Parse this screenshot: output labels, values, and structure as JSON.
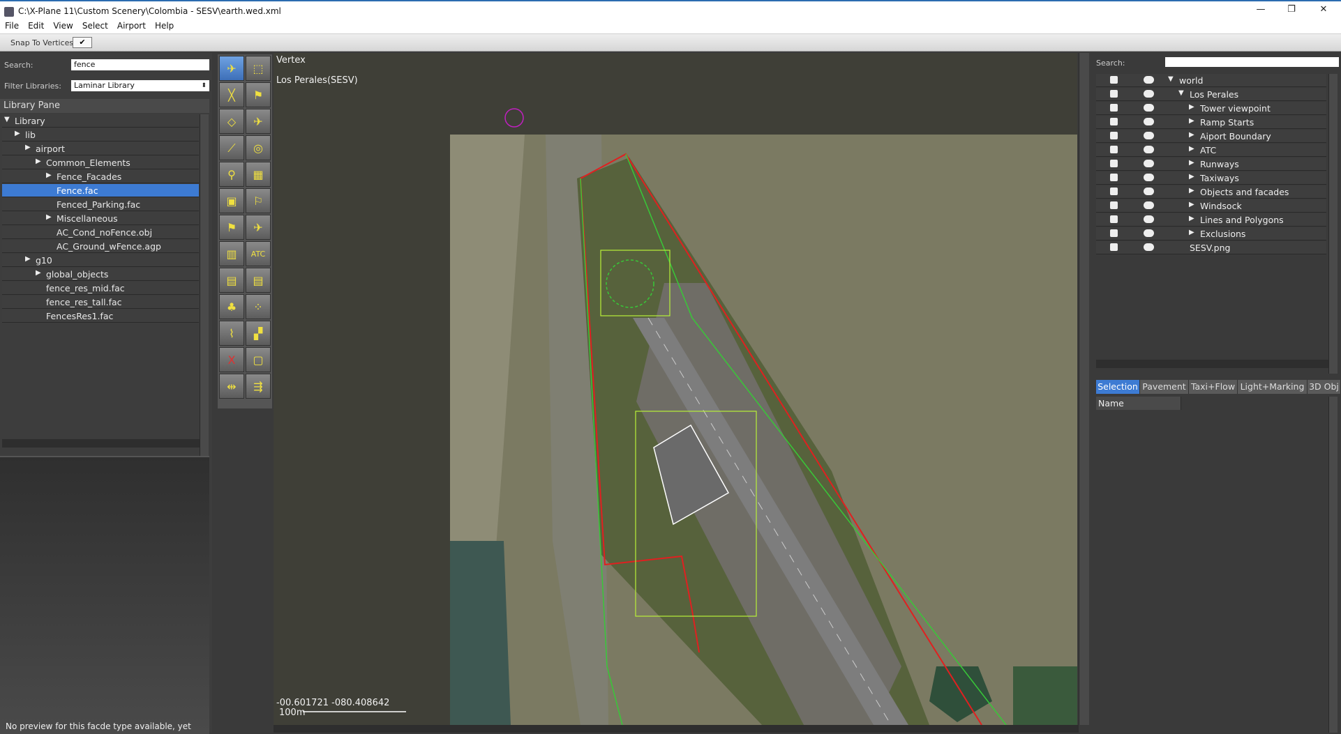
{
  "window": {
    "title": "C:\\X-Plane 11\\Custom Scenery\\Colombia - SESV\\earth.wed.xml",
    "minimize": "—",
    "restore": "❐",
    "close": "✕"
  },
  "menu": [
    "File",
    "Edit",
    "View",
    "Select",
    "Airport",
    "Help"
  ],
  "toolbar": {
    "snap_label": "Snap To Vertices",
    "snap_checked": "✔"
  },
  "library": {
    "search_label": "Search:",
    "search_value": "fence",
    "filter_label": "Filter Libraries:",
    "filter_value": "Laminar Library",
    "pane_title": "Library Pane",
    "items": [
      {
        "label": "Library",
        "arrow": "▼"
      },
      {
        "label": "lib",
        "arrow": "▶"
      },
      {
        "label": "airport",
        "arrow": "▶"
      },
      {
        "label": "Common_Elements",
        "arrow": "▶"
      },
      {
        "label": "Fence_Facades",
        "arrow": "▶"
      },
      {
        "label": "Fence.fac",
        "arrow": ""
      },
      {
        "label": "Fenced_Parking.fac",
        "arrow": ""
      },
      {
        "label": "Miscellaneous",
        "arrow": "▶"
      },
      {
        "label": "AC_Cond_noFence.obj",
        "arrow": ""
      },
      {
        "label": "AC_Ground_wFence.agp",
        "arrow": ""
      },
      {
        "label": "g10",
        "arrow": "▶"
      },
      {
        "label": "global_objects",
        "arrow": "▶"
      },
      {
        "label": "fence_res_mid.fac",
        "arrow": ""
      },
      {
        "label": "fence_res_tall.fac",
        "arrow": ""
      },
      {
        "label": "FencesRes1.fac",
        "arrow": ""
      }
    ],
    "preview_message": "No preview for this facde type available, yet"
  },
  "tools": [
    "✈",
    "⬚",
    "╳",
    "⚑",
    "◇",
    "✈",
    "⟋",
    "◎",
    "⚲",
    "▦",
    "▣",
    "⚐",
    "⚑",
    "✈",
    "▥",
    "ATC",
    "▤",
    "▤",
    "♣",
    "⁘",
    "⌇",
    "▞",
    "X",
    "▢",
    "⇹",
    "⇶"
  ],
  "map": {
    "tool_name": "Vertex",
    "airport_name": "Los Perales(SESV)",
    "coordinates": "-00.601721 -080.408642",
    "scale_label": "100m"
  },
  "hierarchy": {
    "search_label": "Search:",
    "search_value": "",
    "items": [
      {
        "label": "world",
        "arrow": "▼",
        "depth": 0
      },
      {
        "label": "Los Perales",
        "arrow": "▼",
        "depth": 1
      },
      {
        "label": "Tower viewpoint",
        "arrow": "▶",
        "depth": 2
      },
      {
        "label": "Ramp Starts",
        "arrow": "▶",
        "depth": 2
      },
      {
        "label": "Aiport Boundary",
        "arrow": "▶",
        "depth": 2
      },
      {
        "label": "ATC",
        "arrow": "▶",
        "depth": 2
      },
      {
        "label": "Runways",
        "arrow": "▶",
        "depth": 2
      },
      {
        "label": "Taxiways",
        "arrow": "▶",
        "depth": 2
      },
      {
        "label": "Objects and facades",
        "arrow": "▶",
        "depth": 2
      },
      {
        "label": "Windsock",
        "arrow": "▶",
        "depth": 2
      },
      {
        "label": "Lines and Polygons",
        "arrow": "▶",
        "depth": 2
      },
      {
        "label": "Exclusions",
        "arrow": "▶",
        "depth": 2
      },
      {
        "label": "SESV.png",
        "arrow": "",
        "depth": 1
      }
    ]
  },
  "inspector": {
    "tabs": [
      "Selection",
      "Pavement",
      "Taxi+Flow",
      "Light+Marking",
      "3D Obj"
    ],
    "active_tab": "Selection",
    "name_header": "Name"
  }
}
